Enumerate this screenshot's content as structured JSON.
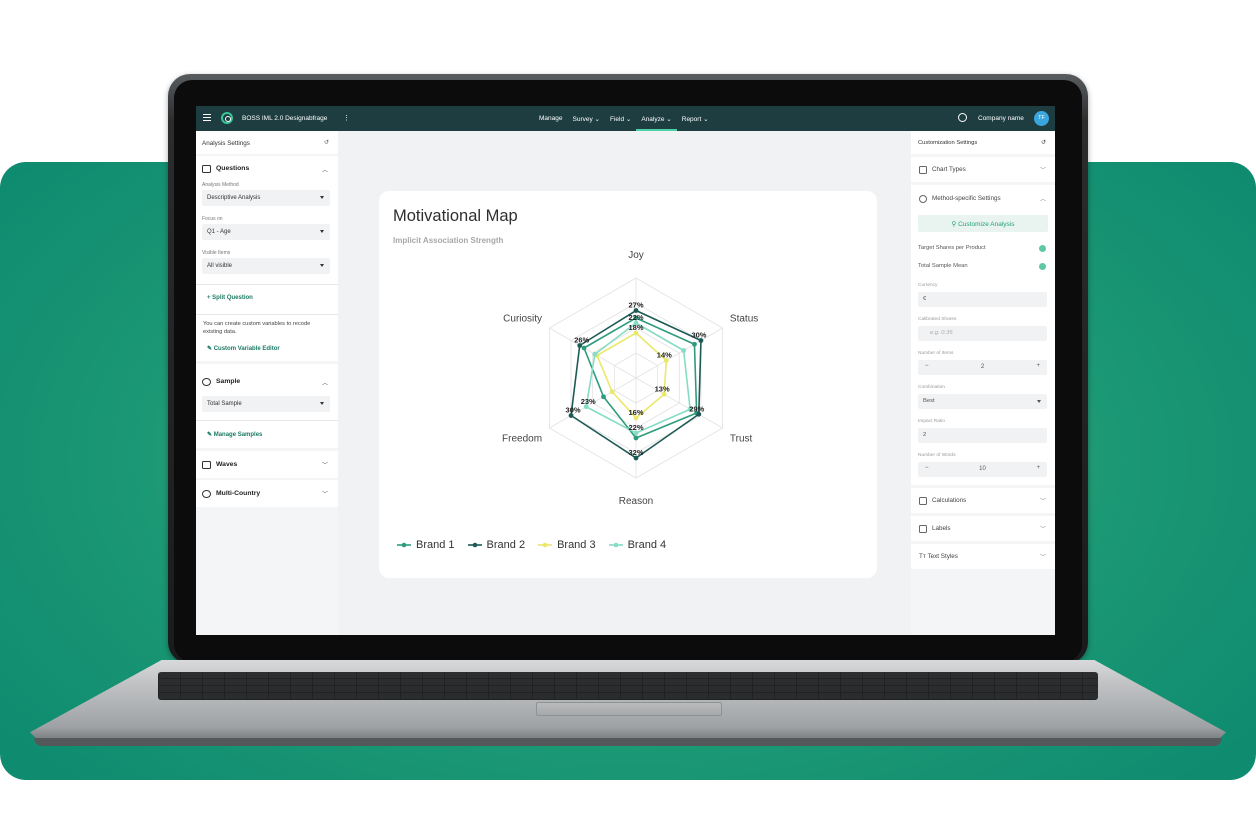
{
  "app": {
    "project_title": "BOSS IML 2.0 Designabfrage",
    "nav": [
      {
        "label": "Manage",
        "chevron": false,
        "active": false
      },
      {
        "label": "Survey",
        "chevron": true,
        "active": false
      },
      {
        "label": "Field",
        "chevron": true,
        "active": false
      },
      {
        "label": "Analyze",
        "chevron": true,
        "active": true
      },
      {
        "label": "Report",
        "chevron": true,
        "active": false
      }
    ],
    "company_name": "Company name",
    "avatar_initials": "TF",
    "accent_color": "#1d3d40"
  },
  "left_panel": {
    "title": "Analysis Settings",
    "questions": {
      "heading": "Questions",
      "analysis_method_label": "Analysis Method",
      "analysis_method_value": "Descriptive Analysis",
      "focus_label": "Focus on",
      "focus_value": "Q1 - Age",
      "visible_items_label": "Visible Items",
      "visible_items_value": "All visible",
      "split_question": "+ Split Question",
      "note": "You can create custom variables to recode existing data.",
      "custom_variable_editor": "Custom Variable Editor"
    },
    "sample": {
      "heading": "Sample",
      "value": "Total Sample",
      "manage_samples": "Manage Samples"
    },
    "waves": {
      "heading": "Waves"
    },
    "multi_country": {
      "heading": "Multi-Country"
    }
  },
  "right_panel": {
    "title": "Customization Settings",
    "chart_types": "Chart Types",
    "method_specific": "Method-specific Settings",
    "customize_analysis": "Customize Analysis",
    "target_shares": "Target Shares per Product",
    "total_sample_mean": "Total Sample Mean",
    "currency_label": "Currency",
    "currency_value": "€",
    "calibrated_shares_label": "Calibrated Shares",
    "calibrated_shares_placeholder": "e.g. 0.35",
    "number_items_label": "Number of Items",
    "number_items_value": "2",
    "combination_label": "Combination",
    "combination_value": "Best",
    "impact_ratio_label": "Impact Ratio",
    "impact_ratio_value": "2",
    "number_words_label": "Number of Words",
    "number_words_value": "10",
    "calculations": "Calculations",
    "labels": "Labels",
    "text_styles": "Text Styles"
  },
  "chart_data": {
    "type": "radar",
    "title": "Motivational Map",
    "subtitle": "Implicit Association Strength",
    "axes": [
      "Joy",
      "Status",
      "Trust",
      "Reason",
      "Freedom",
      "Curiosity"
    ],
    "rmax": 40,
    "series": [
      {
        "name": "Brand 1",
        "color": "#2e9c7c",
        "values": [
          24,
          27,
          28,
          24,
          15,
          24
        ]
      },
      {
        "name": "Brand 2",
        "color": "#1c5a55",
        "values": [
          27,
          30,
          29,
          32,
          30,
          26
        ]
      },
      {
        "name": "Brand 3",
        "color": "#e9e86a",
        "values": [
          18,
          14,
          13,
          16,
          11,
          18
        ]
      },
      {
        "name": "Brand 4",
        "color": "#86dcc4",
        "values": [
          22,
          22,
          25,
          22,
          23,
          19
        ]
      }
    ],
    "data_labels": [
      {
        "text": "27%",
        "axis": 0,
        "value": 27
      },
      {
        "text": "22%",
        "axis": 0,
        "value": 22
      },
      {
        "text": "18%",
        "axis": 0,
        "value": 18
      },
      {
        "text": "30%",
        "axis": 1,
        "value": 30
      },
      {
        "text": "14%",
        "axis": 1,
        "value": 14
      },
      {
        "text": "29%",
        "axis": 2,
        "value": 29
      },
      {
        "text": "13%",
        "axis": 2,
        "value": 13
      },
      {
        "text": "32%",
        "axis": 3,
        "value": 32
      },
      {
        "text": "22%",
        "axis": 3,
        "value": 22
      },
      {
        "text": "16%",
        "axis": 3,
        "value": 16
      },
      {
        "text": "30%",
        "axis": 4,
        "value": 30
      },
      {
        "text": "23%",
        "axis": 4,
        "value": 23
      },
      {
        "text": "26%",
        "axis": 5,
        "value": 26
      }
    ],
    "legend_position": "bottom-left"
  }
}
